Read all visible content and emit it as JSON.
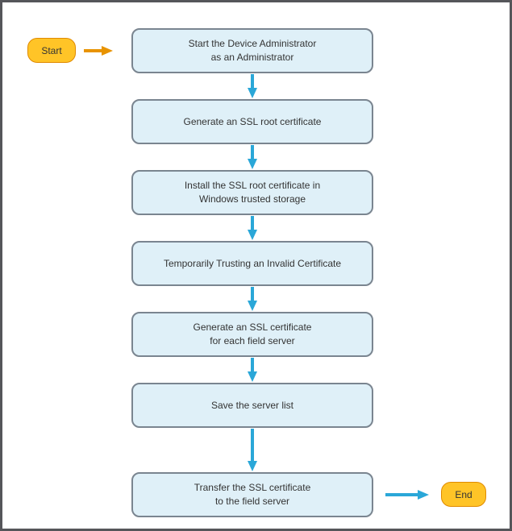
{
  "colors": {
    "frame_border": "#55565a",
    "step_bg": "#dff0f8",
    "step_border": "#7a8590",
    "terminal_bg": "#ffc427",
    "terminal_border": "#e08a00",
    "arrow": "#2aa7d8",
    "arrow_terminal": "#e89300"
  },
  "terminals": {
    "start": "Start",
    "end": "End"
  },
  "steps": {
    "s1": "Start the Device Administrator\nas an Administrator",
    "s2": "Generate an SSL root certificate",
    "s3": "Install the SSL root certificate in\nWindows trusted storage",
    "s4": "Temporarily Trusting an Invalid Certificate",
    "s5": "Generate an SSL certificate\nfor each field server",
    "s6": "Save the server list",
    "s7": "Transfer the SSL certificate\nto the field server"
  }
}
